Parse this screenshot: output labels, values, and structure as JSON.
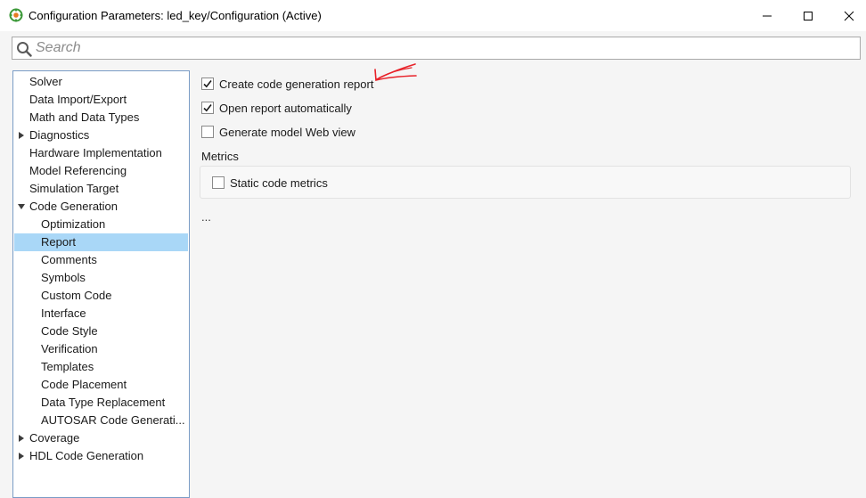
{
  "window": {
    "title": "Configuration Parameters: led_key/Configuration (Active)",
    "controls": [
      "minimize",
      "maximize",
      "close"
    ]
  },
  "search": {
    "placeholder": "Search"
  },
  "tree": {
    "items": [
      {
        "label": "Solver",
        "indent": 0,
        "expander": "none",
        "selected": false
      },
      {
        "label": "Data Import/Export",
        "indent": 0,
        "expander": "none",
        "selected": false
      },
      {
        "label": "Math and Data Types",
        "indent": 0,
        "expander": "none",
        "selected": false
      },
      {
        "label": "Diagnostics",
        "indent": 0,
        "expander": "collapsed",
        "selected": false
      },
      {
        "label": "Hardware Implementation",
        "indent": 0,
        "expander": "none",
        "selected": false
      },
      {
        "label": "Model Referencing",
        "indent": 0,
        "expander": "none",
        "selected": false
      },
      {
        "label": "Simulation Target",
        "indent": 0,
        "expander": "none",
        "selected": false
      },
      {
        "label": "Code Generation",
        "indent": 0,
        "expander": "expanded",
        "selected": false
      },
      {
        "label": "Optimization",
        "indent": 1,
        "expander": "none",
        "selected": false
      },
      {
        "label": "Report",
        "indent": 1,
        "expander": "none",
        "selected": true
      },
      {
        "label": "Comments",
        "indent": 1,
        "expander": "none",
        "selected": false
      },
      {
        "label": "Symbols",
        "indent": 1,
        "expander": "none",
        "selected": false
      },
      {
        "label": "Custom Code",
        "indent": 1,
        "expander": "none",
        "selected": false
      },
      {
        "label": "Interface",
        "indent": 1,
        "expander": "none",
        "selected": false
      },
      {
        "label": "Code Style",
        "indent": 1,
        "expander": "none",
        "selected": false
      },
      {
        "label": "Verification",
        "indent": 1,
        "expander": "none",
        "selected": false
      },
      {
        "label": "Templates",
        "indent": 1,
        "expander": "none",
        "selected": false
      },
      {
        "label": "Code Placement",
        "indent": 1,
        "expander": "none",
        "selected": false
      },
      {
        "label": "Data Type Replacement",
        "indent": 1,
        "expander": "none",
        "selected": false
      },
      {
        "label": "AUTOSAR Code Generati...",
        "indent": 1,
        "expander": "none",
        "selected": false
      },
      {
        "label": "Coverage",
        "indent": 0,
        "expander": "collapsed",
        "selected": false
      },
      {
        "label": "HDL Code Generation",
        "indent": 0,
        "expander": "collapsed",
        "selected": false
      }
    ]
  },
  "report": {
    "options": [
      {
        "label": "Create code generation report",
        "checked": true
      },
      {
        "label": "Open report automatically",
        "checked": true
      },
      {
        "label": "Generate model Web view",
        "checked": false
      }
    ],
    "metrics": {
      "title": "Metrics",
      "static_code_metrics": {
        "label": "Static code metrics",
        "checked": false
      }
    },
    "more": "..."
  },
  "colors": {
    "selection": "#a9d7f7",
    "tree_border": "#7a9cc6",
    "annotation": "#e8232a",
    "icon_green": "#3d9a3a"
  }
}
